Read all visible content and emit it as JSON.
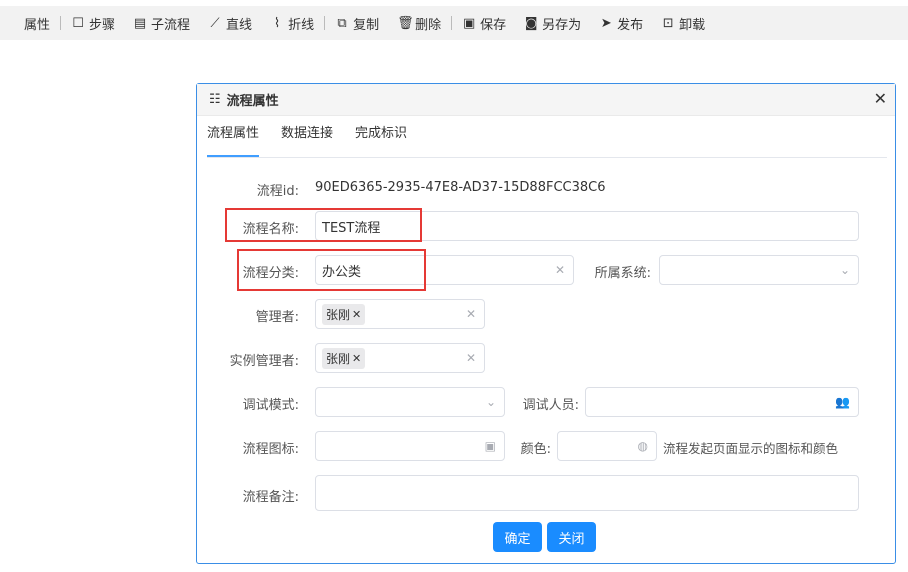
{
  "toolbar": {
    "items": [
      {
        "label": "属性",
        "icon": "properties-icon"
      },
      {
        "label": "步骤",
        "icon": "step-icon"
      },
      {
        "label": "子流程",
        "icon": "subprocess-icon"
      },
      {
        "label": "直线",
        "icon": "line-icon"
      },
      {
        "label": "折线",
        "icon": "polyline-icon"
      },
      {
        "label": "复制",
        "icon": "copy-icon"
      },
      {
        "label": "删除",
        "icon": "delete-icon"
      },
      {
        "label": "保存",
        "icon": "save-icon"
      },
      {
        "label": "另存为",
        "icon": "save-as-icon"
      },
      {
        "label": "发布",
        "icon": "publish-icon"
      },
      {
        "label": "卸载",
        "icon": "uninstall-icon"
      }
    ]
  },
  "dialog": {
    "title": "流程属性",
    "title_icon": "sliders-icon",
    "close": "✕",
    "tabs": [
      "流程属性",
      "数据连接",
      "完成标识"
    ],
    "active_tab": 0,
    "fields": {
      "flow_id_label": "流程id:",
      "flow_id_value": "90ED6365-2935-47E8-AD37-15D88FCC38C6",
      "flow_name_label": "流程名称:",
      "flow_name_value": "TEST流程",
      "flow_category_label": "流程分类:",
      "flow_category_value": "办公类",
      "system_label": "所属系统:",
      "system_value": "",
      "manager_label": "管理者:",
      "manager_tag": "张刚",
      "instance_manager_label": "实例管理者:",
      "instance_manager_tag": "张刚",
      "debug_mode_label": "调试模式:",
      "debug_mode_value": "",
      "debugger_label": "调试人员:",
      "debugger_value": "",
      "flow_icon_label": "流程图标:",
      "flow_icon_value": "",
      "color_label": "颜色:",
      "color_value": "",
      "icon_hint": "流程发起页面显示的图标和颜色",
      "remark_label": "流程备注:",
      "remark_value": ""
    },
    "buttons": {
      "confirm": "确定",
      "close": "关闭"
    },
    "highlight_color": "#e53935",
    "accent_color": "#1a8cff"
  }
}
